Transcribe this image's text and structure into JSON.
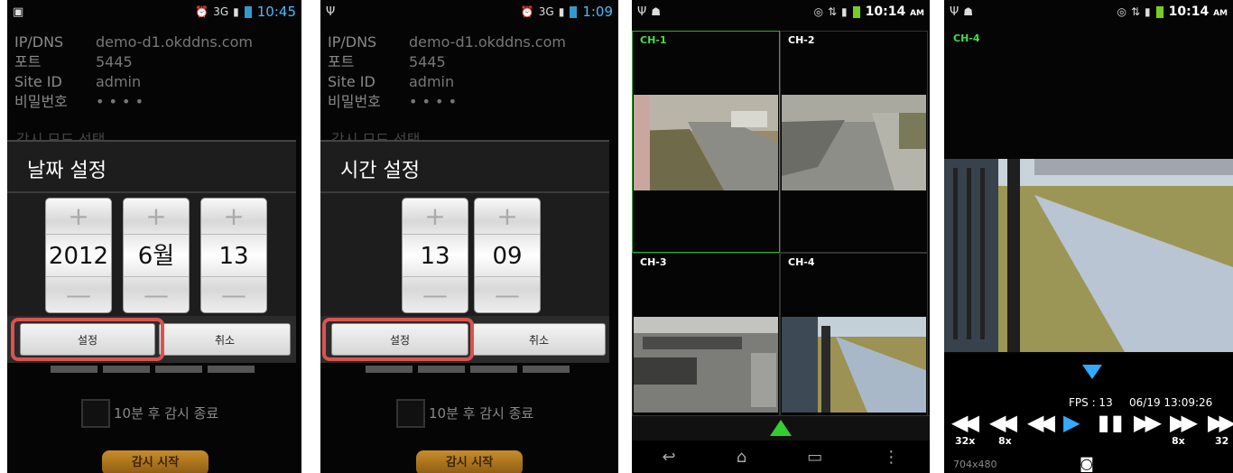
{
  "screen1": {
    "status": {
      "time": "10:45",
      "net": "3G"
    },
    "info": [
      {
        "key": "IP/DNS",
        "value": "demo-d1.okddns.com"
      },
      {
        "key": "포트",
        "value": "5445"
      },
      {
        "key": "Site ID",
        "value": "admin"
      },
      {
        "key": "비밀번호",
        "value": "• • • •"
      }
    ],
    "behind_label": "감시 모드 선택",
    "dialog_title": "날짜 설정",
    "pickers": [
      "2012",
      "6월",
      "13"
    ],
    "plus": "+",
    "minus": "—",
    "ok": "설정",
    "cancel": "취소",
    "auto_stop": "10분 후 감시 종료",
    "start": "감시 시작"
  },
  "screen2": {
    "status": {
      "time": "1:09",
      "net": "3G"
    },
    "info": [
      {
        "key": "IP/DNS",
        "value": "demo-d1.okddns.com"
      },
      {
        "key": "포트",
        "value": "5445"
      },
      {
        "key": "Site ID",
        "value": "admin"
      },
      {
        "key": "비밀번호",
        "value": "• • • •"
      }
    ],
    "behind_label": "감시 모드 선택",
    "dialog_title": "시간 설정",
    "pickers": [
      "13",
      "09"
    ],
    "plus": "+",
    "minus": "—",
    "ok": "설정",
    "cancel": "취소",
    "auto_stop": "10분 후 감시 종료",
    "start": "감시 시작"
  },
  "screen3": {
    "status": {
      "time": "10:14",
      "ampm": "AM"
    },
    "channels": [
      "CH-1",
      "CH-2",
      "CH-3",
      "CH-4"
    ],
    "nav": {
      "back": "↩",
      "home": "⌂",
      "recent": "▭",
      "menu": "⋮"
    }
  },
  "screen4": {
    "status": {
      "time": "10:14",
      "ampm": "AM"
    },
    "channel": "CH-4",
    "fps": "FPS : 13",
    "timestamp": "06/19 13:09:26",
    "speeds": {
      "rew32": "32x",
      "rew8": "8x",
      "ff8": "8x",
      "ff32": "32"
    },
    "resolution": "704x480"
  },
  "colors": {
    "accent_green": "#33cc33",
    "accent_blue": "#33aaff",
    "highlight_red": "#d9534f"
  }
}
